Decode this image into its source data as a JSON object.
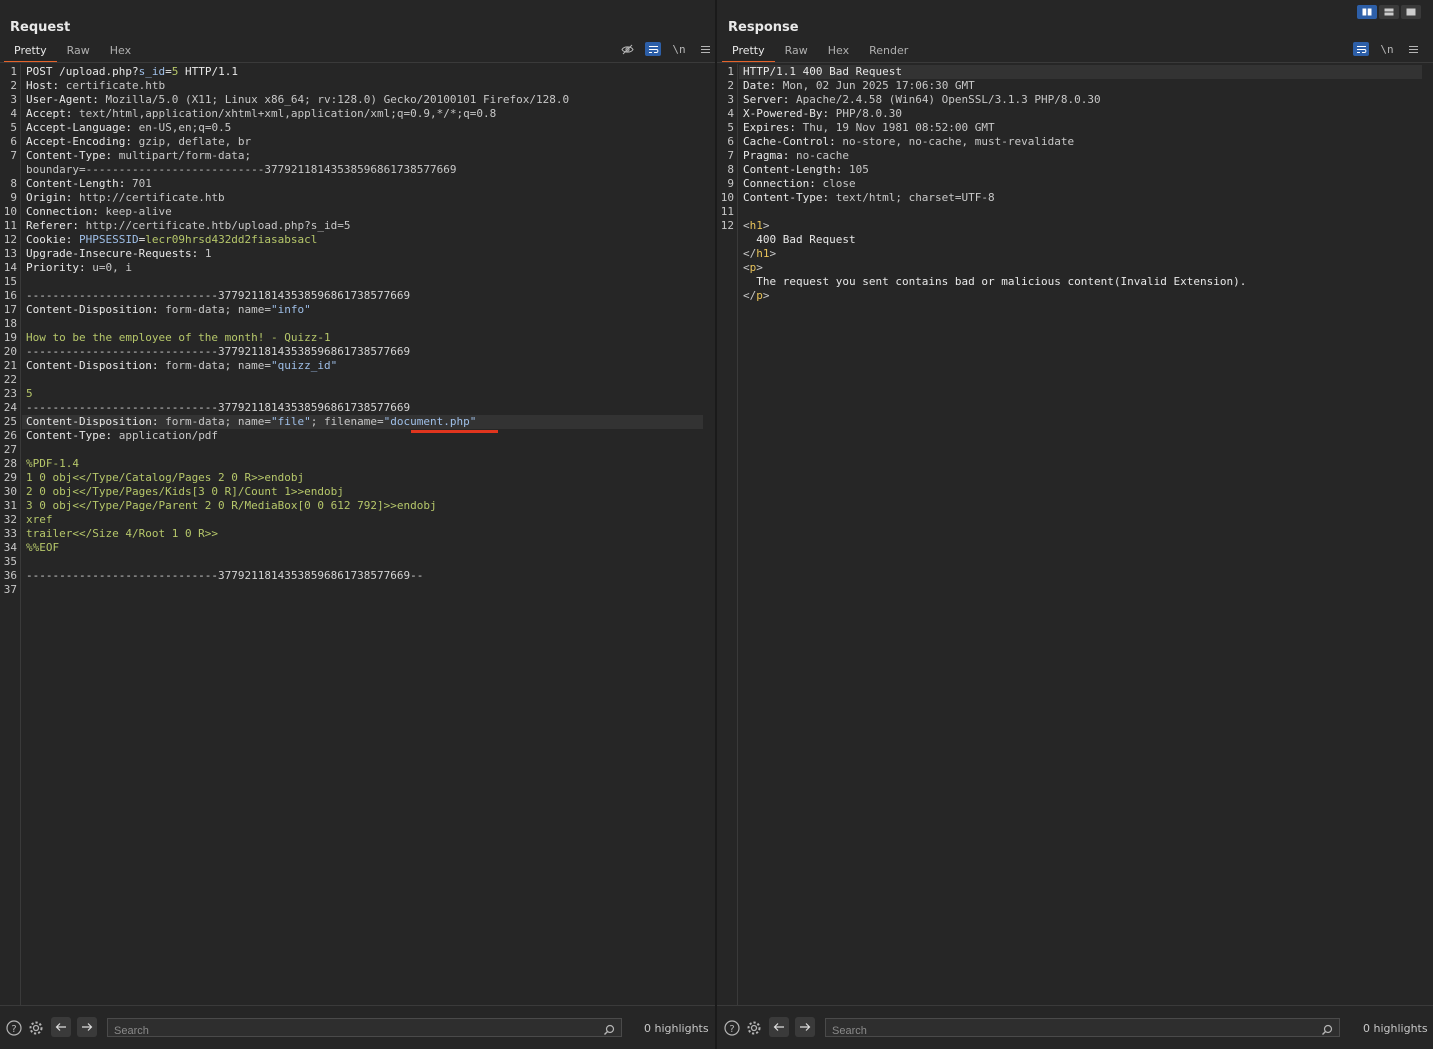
{
  "request": {
    "title": "Request",
    "tabs": [
      "Pretty",
      "Raw",
      "Hex"
    ],
    "active_tab": "Pretty",
    "lines": [
      {
        "n": "1",
        "segs": [
          [
            "POST /upload.php?",
            "kh"
          ],
          [
            "s_id",
            "st"
          ],
          [
            "=",
            "kh"
          ],
          [
            "5",
            "gr"
          ],
          [
            " HTTP/1.1",
            "kh"
          ]
        ]
      },
      {
        "n": "2",
        "segs": [
          [
            "Host: ",
            "kh"
          ],
          [
            "certificate.htb",
            "vh"
          ]
        ]
      },
      {
        "n": "3",
        "segs": [
          [
            "User-Agent: ",
            "kh"
          ],
          [
            "Mozilla/5.0 (X11; Linux x86_64; rv:128.0) Gecko/20100101 Firefox/128.0",
            "vh"
          ]
        ]
      },
      {
        "n": "4",
        "segs": [
          [
            "Accept: ",
            "kh"
          ],
          [
            "text/html,application/xhtml+xml,application/xml;q=0.9,*/*;q=0.8",
            "vh"
          ]
        ]
      },
      {
        "n": "5",
        "segs": [
          [
            "Accept-Language: ",
            "kh"
          ],
          [
            "en-US,en;q=0.5",
            "vh"
          ]
        ]
      },
      {
        "n": "6",
        "segs": [
          [
            "Accept-Encoding: ",
            "kh"
          ],
          [
            "gzip, deflate, br",
            "vh"
          ]
        ]
      },
      {
        "n": "7",
        "segs": [
          [
            "Content-Type: ",
            "kh"
          ],
          [
            "multipart/form-data;",
            "vh"
          ]
        ]
      },
      {
        "n": "",
        "segs": [
          [
            "boundary=---------------------------37792118143538596861738577669",
            "vh"
          ]
        ]
      },
      {
        "n": "8",
        "segs": [
          [
            "Content-Length: ",
            "kh"
          ],
          [
            "701",
            "vh"
          ]
        ]
      },
      {
        "n": "9",
        "segs": [
          [
            "Origin: ",
            "kh"
          ],
          [
            "http://certificate.htb",
            "vh"
          ]
        ]
      },
      {
        "n": "10",
        "segs": [
          [
            "Connection: ",
            "kh"
          ],
          [
            "keep-alive",
            "vh"
          ]
        ]
      },
      {
        "n": "11",
        "segs": [
          [
            "Referer: ",
            "kh"
          ],
          [
            "http://certificate.htb/upload.php?s_id=5",
            "vh"
          ]
        ]
      },
      {
        "n": "12",
        "segs": [
          [
            "Cookie: ",
            "kh"
          ],
          [
            "PHPSESSID",
            "st"
          ],
          [
            "=",
            "kh"
          ],
          [
            "lecr09hrsd432dd2fiasabsacl",
            "gr"
          ]
        ]
      },
      {
        "n": "13",
        "segs": [
          [
            "Upgrade-Insecure-Requests: ",
            "kh"
          ],
          [
            "1",
            "vh"
          ]
        ]
      },
      {
        "n": "14",
        "segs": [
          [
            "Priority: ",
            "kh"
          ],
          [
            "u=0, i",
            "vh"
          ]
        ]
      },
      {
        "n": "15",
        "segs": []
      },
      {
        "n": "16",
        "segs": [
          [
            "-----------------------------37792118143538596861738577669",
            "pl"
          ]
        ]
      },
      {
        "n": "17",
        "segs": [
          [
            "Content-Disposition: ",
            "kh"
          ],
          [
            "form-data; name=",
            "vh"
          ],
          [
            "\"info\"",
            "st"
          ]
        ]
      },
      {
        "n": "18",
        "segs": []
      },
      {
        "n": "19",
        "segs": [
          [
            "How to be the employee of the month! - Quizz-1",
            "gr"
          ]
        ]
      },
      {
        "n": "20",
        "segs": [
          [
            "-----------------------------37792118143538596861738577669",
            "pl"
          ]
        ]
      },
      {
        "n": "21",
        "segs": [
          [
            "Content-Disposition: ",
            "kh"
          ],
          [
            "form-data; name=",
            "vh"
          ],
          [
            "\"quizz_id\"",
            "st"
          ]
        ]
      },
      {
        "n": "22",
        "segs": []
      },
      {
        "n": "23",
        "segs": [
          [
            "5",
            "gr"
          ]
        ]
      },
      {
        "n": "24",
        "segs": [
          [
            "-----------------------------37792118143538596861738577669",
            "pl"
          ]
        ]
      },
      {
        "n": "25",
        "segs": [
          [
            "Content-Disposition: ",
            "kh"
          ],
          [
            "form-data; name=",
            "vh"
          ],
          [
            "\"file\"",
            "st"
          ],
          [
            "; filename=",
            "vh"
          ],
          [
            "\"document.php\"",
            "st"
          ]
        ]
      },
      {
        "n": "26",
        "segs": [
          [
            "Content-Type: ",
            "kh"
          ],
          [
            "application/pdf",
            "vh"
          ]
        ]
      },
      {
        "n": "27",
        "segs": []
      },
      {
        "n": "28",
        "segs": [
          [
            "%PDF-1.4",
            "gr"
          ]
        ]
      },
      {
        "n": "29",
        "segs": [
          [
            "1 0 obj<</Type/Catalog/Pages 2 0 R>>endobj",
            "gr"
          ]
        ]
      },
      {
        "n": "30",
        "segs": [
          [
            "2 0 obj<</Type/Pages/Kids[3 0 R]/Count 1>>endobj",
            "gr"
          ]
        ]
      },
      {
        "n": "31",
        "segs": [
          [
            "3 0 obj<</Type/Page/Parent 2 0 R/MediaBox[0 0 612 792]>>endobj",
            "gr"
          ]
        ]
      },
      {
        "n": "32",
        "segs": [
          [
            "xref",
            "gr"
          ]
        ]
      },
      {
        "n": "33",
        "segs": [
          [
            "trailer<</Size 4/Root 1 0 R>>",
            "gr"
          ]
        ]
      },
      {
        "n": "34",
        "segs": [
          [
            "%%EOF",
            "gr"
          ]
        ]
      },
      {
        "n": "35",
        "segs": []
      },
      {
        "n": "36",
        "segs": [
          [
            "-----------------------------37792118143538596861738577669--",
            "pl"
          ]
        ]
      },
      {
        "n": "37",
        "segs": []
      }
    ],
    "search_placeholder": "Search",
    "highlights": "0 highlights"
  },
  "response": {
    "title": "Response",
    "tabs": [
      "Pretty",
      "Raw",
      "Hex",
      "Render"
    ],
    "active_tab": "Pretty",
    "lines": [
      {
        "n": "1",
        "segs": [
          [
            "HTTP/1.1 400 Bad Request",
            "kh"
          ]
        ]
      },
      {
        "n": "2",
        "segs": [
          [
            "Date: ",
            "kh"
          ],
          [
            "Mon, 02 Jun 2025 17:06:30 GMT",
            "vh"
          ]
        ]
      },
      {
        "n": "3",
        "segs": [
          [
            "Server: ",
            "kh"
          ],
          [
            "Apache/2.4.58 (Win64) OpenSSL/3.1.3 PHP/8.0.30",
            "vh"
          ]
        ]
      },
      {
        "n": "4",
        "segs": [
          [
            "X-Powered-By: ",
            "kh"
          ],
          [
            "PHP/8.0.30",
            "vh"
          ]
        ]
      },
      {
        "n": "5",
        "segs": [
          [
            "Expires: ",
            "kh"
          ],
          [
            "Thu, 19 Nov 1981 08:52:00 GMT",
            "vh"
          ]
        ]
      },
      {
        "n": "6",
        "segs": [
          [
            "Cache-Control: ",
            "kh"
          ],
          [
            "no-store, no-cache, must-revalidate",
            "vh"
          ]
        ]
      },
      {
        "n": "7",
        "segs": [
          [
            "Pragma: ",
            "kh"
          ],
          [
            "no-cache",
            "vh"
          ]
        ]
      },
      {
        "n": "8",
        "segs": [
          [
            "Content-Length: ",
            "kh"
          ],
          [
            "105",
            "vh"
          ]
        ]
      },
      {
        "n": "9",
        "segs": [
          [
            "Connection: ",
            "kh"
          ],
          [
            "close",
            "vh"
          ]
        ]
      },
      {
        "n": "10",
        "segs": [
          [
            "Content-Type: ",
            "kh"
          ],
          [
            "text/html; charset=UTF-8",
            "vh"
          ]
        ]
      },
      {
        "n": "11",
        "segs": []
      },
      {
        "n": "12",
        "segs": [
          [
            "<",
            "vh"
          ],
          [
            "h1",
            "ta"
          ],
          [
            ">",
            "vh"
          ]
        ]
      },
      {
        "n": "",
        "segs": [
          [
            "  400 Bad Request",
            "kh"
          ]
        ]
      },
      {
        "n": "",
        "segs": [
          [
            "</",
            "vh"
          ],
          [
            "h1",
            "ta"
          ],
          [
            ">",
            "vh"
          ]
        ]
      },
      {
        "n": "",
        "segs": [
          [
            "<",
            "vh"
          ],
          [
            "p",
            "ta"
          ],
          [
            ">",
            "vh"
          ]
        ]
      },
      {
        "n": "",
        "segs": [
          [
            "  The request you sent contains bad or malicious content(Invalid Extension).",
            "kh"
          ]
        ]
      },
      {
        "n": "",
        "segs": [
          [
            "</",
            "vh"
          ],
          [
            "p",
            "ta"
          ],
          [
            ">",
            "vh"
          ]
        ]
      }
    ],
    "search_placeholder": "Search",
    "highlights": "0 highlights"
  },
  "colors": {
    "accent": "#e5632b",
    "underline": "#e0351e",
    "toggle_on": "#2d5fa8",
    "background": "#262626"
  }
}
